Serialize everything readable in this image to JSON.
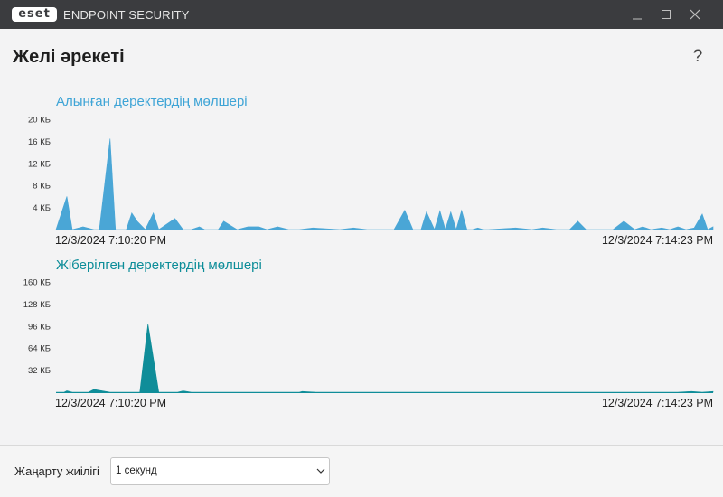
{
  "window": {
    "logo_text": "eset",
    "app_name": "ENDPOINT SECURITY",
    "controls": [
      "minimize-icon",
      "maximize-icon",
      "close-icon"
    ]
  },
  "page": {
    "title": "Желі әрекеті",
    "help_label": "?"
  },
  "charts": [
    {
      "title": "Алынған деректердің мөлшері",
      "color": "#4aa6d6",
      "start_time": "12/3/2024 7:10:20 PM",
      "end_time": "12/3/2024 7:14:23 PM"
    },
    {
      "title": "Жіберілген деректердің мөлшері",
      "color": "#0f8d99",
      "start_time": "12/3/2024 7:10:20 PM",
      "end_time": "12/3/2024 7:14:23 PM"
    }
  ],
  "chart_data": [
    {
      "type": "area",
      "title": "Алынған деректердің мөлшері",
      "x_range": [
        "12/3/2024 7:10:20 PM",
        "12/3/2024 7:14:23 PM"
      ],
      "y_unit": "КБ",
      "y_ticks": [
        "20 КБ",
        "16 КБ",
        "12 КБ",
        "8 КБ",
        "4 КБ"
      ],
      "ylim": [
        0,
        20
      ],
      "x_seconds": [
        0,
        4,
        6,
        10,
        14,
        16,
        20,
        22,
        26,
        28,
        30,
        33,
        36,
        38,
        44,
        47,
        50,
        53,
        55,
        57,
        60,
        62,
        67,
        71,
        75,
        78,
        82,
        86,
        90,
        95,
        105,
        110,
        115,
        121,
        125,
        129,
        132,
        135,
        137,
        140,
        142,
        144,
        146,
        148,
        150,
        152,
        154,
        156,
        158,
        160,
        170,
        176,
        180,
        185,
        190,
        193,
        196,
        199,
        202,
        206,
        210,
        214,
        217,
        220,
        224,
        227,
        230,
        233,
        236,
        239,
        241,
        243
      ],
      "values": [
        0,
        6,
        0,
        0.5,
        0,
        0,
        16.5,
        0,
        0,
        3,
        1.5,
        0,
        3,
        0,
        2,
        0,
        0,
        0.5,
        0,
        0,
        0,
        1.5,
        0,
        0.5,
        0.5,
        0,
        0.5,
        0,
        0,
        0.3,
        0,
        0.3,
        0,
        0,
        0,
        3.5,
        0,
        0,
        3.2,
        0,
        3.4,
        0,
        3.2,
        0,
        3.5,
        0,
        0,
        0.3,
        0,
        0,
        0.3,
        0,
        0.3,
        0,
        0,
        1.5,
        0,
        0,
        0,
        0,
        1.5,
        0,
        0.5,
        0,
        0.3,
        0,
        0.5,
        0,
        0.3,
        2.8,
        0,
        0.5
      ]
    },
    {
      "type": "area",
      "title": "Жіберілген деректердің мөлшері",
      "x_range": [
        "12/3/2024 7:10:20 PM",
        "12/3/2024 7:14:23 PM"
      ],
      "y_unit": "КБ",
      "y_ticks": [
        "160 КБ",
        "128 КБ",
        "96 КБ",
        "64 КБ",
        "32 КБ"
      ],
      "ylim": [
        0,
        160
      ],
      "x_seconds": [
        0,
        3,
        4,
        6,
        10,
        12,
        14,
        20,
        22,
        24,
        28,
        31,
        34,
        38,
        45,
        47,
        50,
        60,
        65,
        90,
        91,
        96,
        230,
        235,
        239,
        243
      ],
      "values": [
        0,
        0,
        2,
        0,
        0,
        0,
        4,
        0,
        0,
        0,
        0,
        0,
        99,
        0,
        0,
        2,
        0,
        0,
        0,
        0,
        1,
        0,
        0,
        1,
        0,
        1
      ]
    }
  ],
  "footer": {
    "label": "Жаңарту жиілігі",
    "selected": "1 секунд"
  }
}
